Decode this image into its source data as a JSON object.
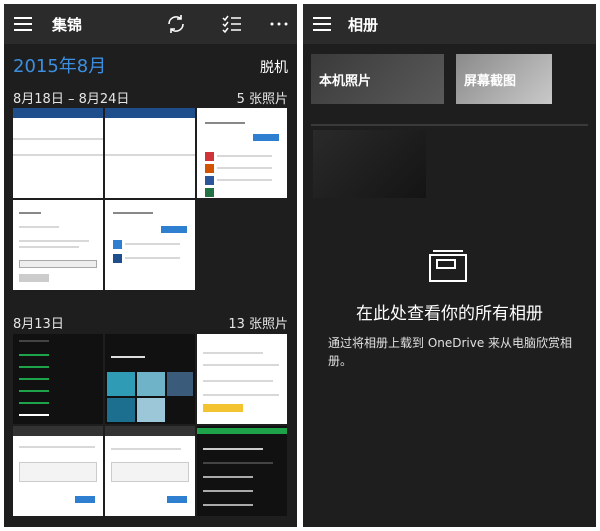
{
  "left": {
    "title": "集锦",
    "icons": [
      "menu-icon",
      "sync-icon",
      "select-icon",
      "more-icon"
    ],
    "month": "2015年8月",
    "offline": "脱机",
    "groups": [
      {
        "date": "8月18日 – 8月24日",
        "count": "5 张照片"
      },
      {
        "date": "8月13日",
        "count": "13 张照片"
      }
    ],
    "accent": "#3c8fe0"
  },
  "right": {
    "title": "相册",
    "albums": [
      {
        "label": "本机照片"
      },
      {
        "label": "屏幕截图"
      }
    ],
    "empty_title": "在此处查看你的所有相册",
    "empty_desc": "通过将相册上载到 OneDrive 来从电脑欣赏相册。"
  }
}
